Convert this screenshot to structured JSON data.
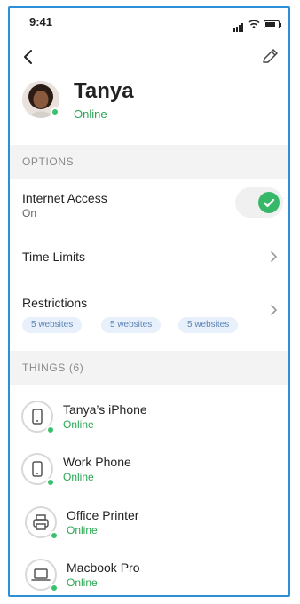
{
  "status_bar": {
    "time": "9:41"
  },
  "profile": {
    "name": "Tanya",
    "status": "Online"
  },
  "options": {
    "header": "OPTIONS",
    "internet_access": {
      "label": "Internet Access",
      "value": "On"
    },
    "time_limits": {
      "label": "Time Limits"
    },
    "restrictions": {
      "label": "Restrictions",
      "pills": [
        "5 websites",
        "5 websites",
        "5 websites"
      ]
    }
  },
  "things": {
    "header": "THINGS (6)",
    "items": [
      {
        "name": "Tanya’s iPhone",
        "status": "Online",
        "icon": "phone-icon"
      },
      {
        "name": "Work Phone",
        "status": "Online",
        "icon": "phone-icon"
      },
      {
        "name": "Office Printer",
        "status": "Online",
        "icon": "printer-icon"
      },
      {
        "name": "Macbook Pro",
        "status": "Online",
        "icon": "laptop-icon"
      }
    ]
  },
  "colors": {
    "accent_green": "#37b868",
    "frame_blue": "#2d8fd6",
    "pill_bg": "#e8f0fb"
  }
}
